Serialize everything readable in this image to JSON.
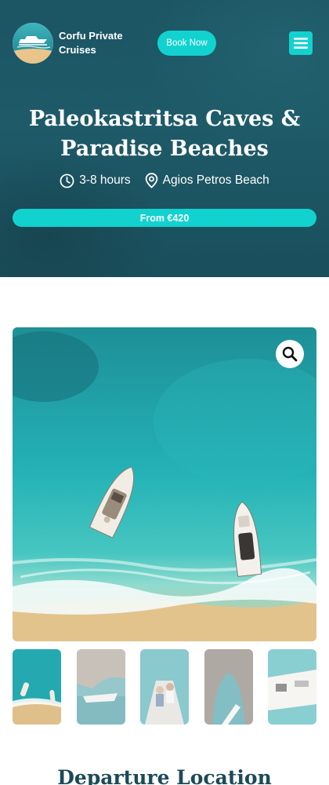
{
  "header": {
    "brand_name": "Corfu Private Cruises",
    "book_button": "Book Now",
    "menu_icon": "hamburger-menu-icon"
  },
  "hero": {
    "title": "Paleokastritsa Caves & Paradise Beaches",
    "duration": "3-8 hours",
    "location": "Agios Petros Beach",
    "price": "From €420"
  },
  "gallery": {
    "zoom_icon": "magnifier-icon",
    "thumbnails": [
      {
        "subject": "boats-aerial"
      },
      {
        "subject": "boat-near-cliffs"
      },
      {
        "subject": "passengers-on-boat"
      },
      {
        "subject": "sea-cave-boat"
      },
      {
        "subject": "boat-deck"
      }
    ]
  },
  "sections": {
    "departure_title": "Departure Location"
  },
  "colors": {
    "hero_bg": "#1c5563",
    "accent": "#12d2cf",
    "heading": "#1c4a57",
    "white": "#ffffff"
  }
}
